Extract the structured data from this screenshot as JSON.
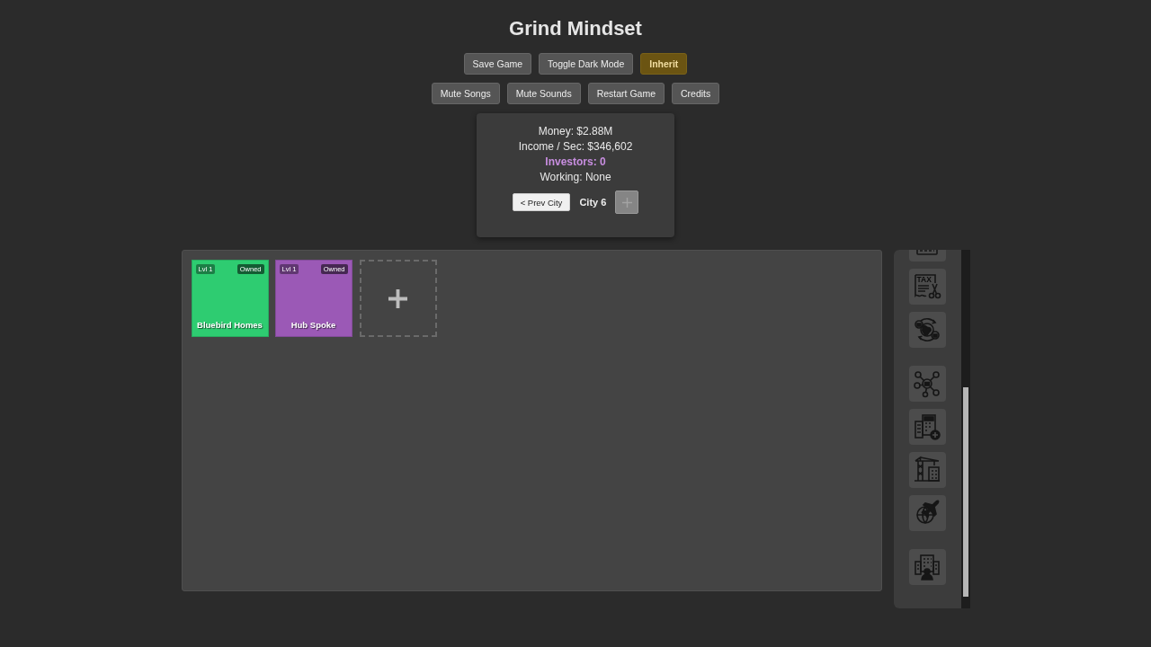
{
  "title": "Grind Mindset",
  "toolbar_rows": [
    [
      {
        "label": "Save Game",
        "highlighted": false
      },
      {
        "label": "Toggle Dark Mode",
        "highlighted": false
      },
      {
        "label": "Inherit",
        "highlighted": true
      }
    ],
    [
      {
        "label": "Mute Songs",
        "highlighted": false
      },
      {
        "label": "Mute Sounds",
        "highlighted": false
      },
      {
        "label": "Restart Game",
        "highlighted": false
      },
      {
        "label": "Credits",
        "highlighted": false
      }
    ]
  ],
  "stats": [
    {
      "kind": "plain",
      "text": "Money: $2.88M"
    },
    {
      "kind": "plain",
      "text": "Income / Sec: $346,602"
    },
    {
      "kind": "investors",
      "text": "Investors: 0"
    },
    {
      "kind": "plain",
      "text": "Working: None"
    }
  ],
  "city_nav": {
    "prev_label": "< Prev City",
    "city": "City 6",
    "next_disabled": true
  },
  "buildings": [
    {
      "name": "Bluebird Homes",
      "level": "Lvl 1",
      "status": "Owned",
      "color": "#2ecc71"
    },
    {
      "name": "Hub Spoke",
      "level": "Lvl 1",
      "status": "Owned",
      "color": "#9b59b6"
    }
  ],
  "sidebar": {
    "groups": [
      [
        {
          "kind": "document"
        },
        {
          "kind": "tax",
          "label": "TAX"
        },
        {
          "kind": "globe-exchange"
        }
      ],
      [
        {
          "kind": "network"
        },
        {
          "kind": "building-calculator"
        },
        {
          "kind": "crane"
        },
        {
          "kind": "globe-airplane"
        }
      ],
      [
        {
          "kind": "office"
        }
      ]
    ]
  }
}
